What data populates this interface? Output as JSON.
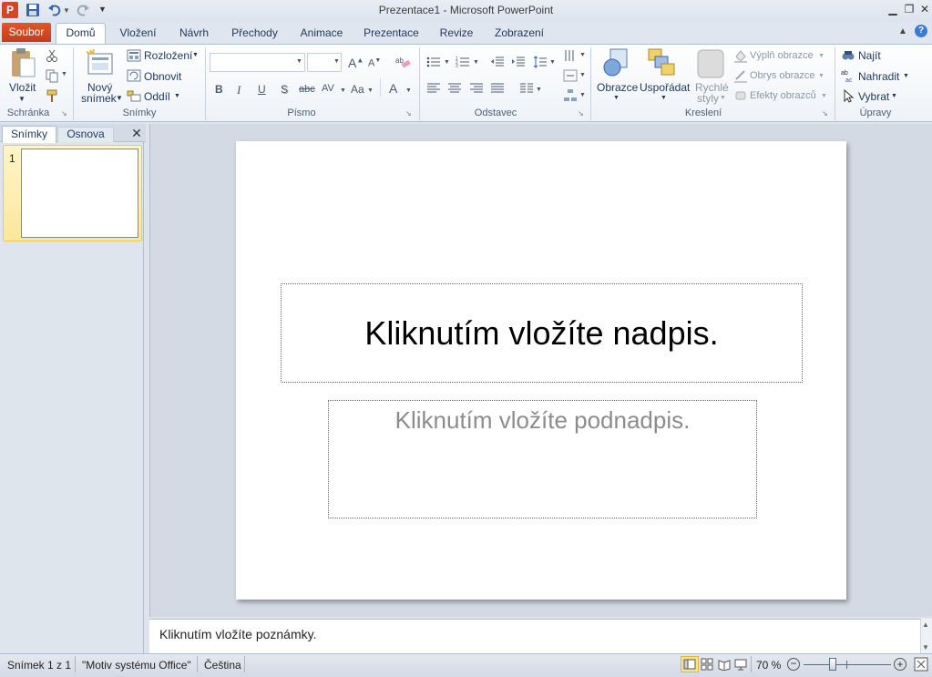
{
  "window": {
    "title": "Prezentace1 - Microsoft PowerPoint",
    "app_icon_letter": "P"
  },
  "quick_access": [
    "save-icon",
    "undo-icon",
    "redo-icon",
    "customize-icon"
  ],
  "tabs": {
    "file": "Soubor",
    "items": [
      "Domů",
      "Vložení",
      "Návrh",
      "Přechody",
      "Animace",
      "Prezentace",
      "Revize",
      "Zobrazení"
    ]
  },
  "ribbon": {
    "clipboard": {
      "paste": "Vložit",
      "group": "Schránka"
    },
    "slides": {
      "new_slide_line1": "Nový",
      "new_slide_line2": "snímek",
      "layout": "Rozložení",
      "reset": "Obnovit",
      "section": "Oddíl",
      "group": "Snímky"
    },
    "font": {
      "group": "Písmo",
      "buttons": [
        "B",
        "I",
        "U",
        "S",
        "abc",
        "AV",
        "Aa",
        "A"
      ]
    },
    "paragraph": {
      "group": "Odstavec"
    },
    "drawing": {
      "shapes": "Obrazce",
      "arrange": "Uspořádat",
      "quick_styles_line1": "Rychlé",
      "quick_styles_line2": "styly",
      "fill": "Výplň obrazce",
      "outline": "Obrys obrazce",
      "effects": "Efekty obrazců",
      "group": "Kreslení"
    },
    "editing": {
      "find": "Najít",
      "replace": "Nahradit",
      "select": "Vybrat",
      "group": "Úpravy"
    }
  },
  "panel": {
    "tab_slides": "Snímky",
    "tab_outline": "Osnova",
    "thumbnail_number": "1"
  },
  "slide": {
    "title_placeholder": "Kliknutím vložíte nadpis.",
    "subtitle_placeholder": "Kliknutím vložíte podnadpis."
  },
  "notes": {
    "placeholder": "Kliknutím vložíte poznámky."
  },
  "status": {
    "slide_info": "Snímek 1 z 1",
    "theme": "\"Motiv systému Office\"",
    "language": "Čeština",
    "zoom": "70 %"
  },
  "colors": {
    "accent_file_tab": "#d24726",
    "ribbon_text": "#1e395b"
  }
}
